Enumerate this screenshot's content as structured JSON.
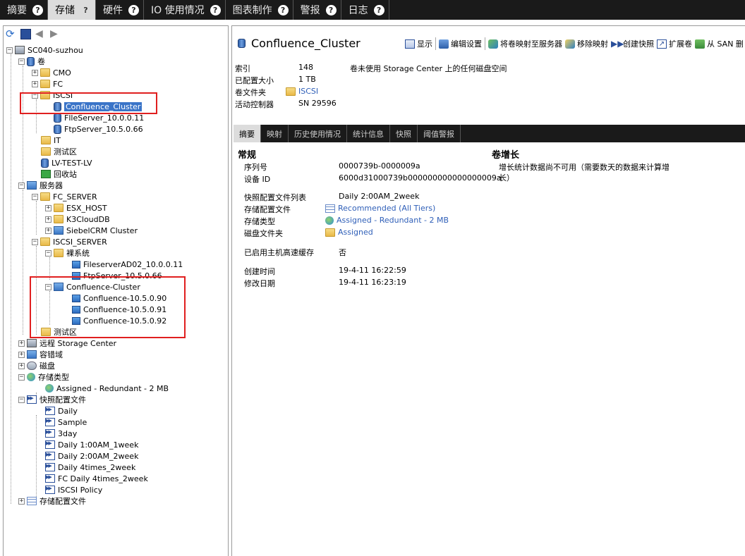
{
  "top_tabs": [
    {
      "label": "摘要"
    },
    {
      "label": "存储"
    },
    {
      "label": "硬件"
    },
    {
      "label": "IO 使用情况"
    },
    {
      "label": "图表制作"
    },
    {
      "label": "警报"
    },
    {
      "label": "日志"
    }
  ],
  "top_tab_help": "?",
  "tree": {
    "root": "SC040-suzhou",
    "volumes": "卷",
    "cmo": "CMO",
    "fc": "FC",
    "iscsi": "ISCSI",
    "confluence_cluster": "Confluence_Cluster",
    "fileserver": "FlleServer_10.0.0.11",
    "ftpserver": "FtpServer_10.5.0.66",
    "it": "IT",
    "test_area": "测试区",
    "lv_test": "LV-TEST-LV",
    "recycle": "回收站",
    "servers": "服务器",
    "fc_server": "FC_SERVER",
    "esx_host": "ESX_HOST",
    "k3clouddb": "K3CloudDB",
    "siebelcrm": "SiebelCRM Cluster",
    "iscsi_server": "ISCSI_SERVER",
    "bare_system": "裸系统",
    "fileserver_ad02": "FileserverAD02_10.0.0.11",
    "ftpserver_srv": "FtpServer_10.5.0.66",
    "confluence_cluster_srv": "Confluence-Cluster",
    "conf90": "Confluence-10.5.0.90",
    "conf91": "Confluence-10.5.0.91",
    "conf92": "Confluence-10.5.0.92",
    "test_area2": "测试区",
    "remote_sc": "远程 Storage Center",
    "fault_domain": "容错域",
    "disks": "磁盘",
    "storage_type": "存储类型",
    "assigned_redundant": "Assigned - Redundant - 2 MB",
    "snapshot_profiles": "快照配置文件",
    "snap_daily": "Daily",
    "snap_sample": "Sample",
    "snap_3day": "3day",
    "snap_d1": "Daily 1:00AM_1week",
    "snap_d2": "Daily 2:00AM_2week",
    "snap_d4": "Daily 4times_2week",
    "snap_fc": "FC Daily 4times_2week",
    "snap_iscsi": "ISCSI Policy",
    "storage_profiles": "存储配置文件"
  },
  "volume": {
    "title": "Confluence_Cluster",
    "actions": {
      "show": "显示",
      "edit": "编辑设置",
      "map": "将卷映射至服务器",
      "unmap": "移除映射",
      "snapshot": "创建快照",
      "expand": "扩展卷",
      "from_san": "从 SAN 删"
    },
    "index_label": "索引",
    "index_value": "148",
    "index_note": "卷未使用 Storage Center 上的任何磁盘空间",
    "size_label": "已配置大小",
    "size_value": "1 TB",
    "folder_label": "卷文件夹",
    "folder_value": "ISCSI",
    "controller_label": "活动控制器",
    "controller_value": "SN 29596"
  },
  "sub_tabs": [
    "摘要",
    "映射",
    "历史使用情况",
    "统计信息",
    "快照",
    "阈值警报"
  ],
  "summary": {
    "general_title": "常规",
    "growth_title": "卷增长",
    "growth_text_1": "增长统计数据尚不可用（需要数天的数据来计算增",
    "growth_text_2": "长）",
    "serial_label": "序列号",
    "serial_value": "0000739b-0000009a",
    "device_label": "设备 ID",
    "device_value": "6000d31000739b000000000000000009a",
    "snap_profiles_label": "快照配置文件列表",
    "snap_profiles_value": "Daily 2:00AM_2week",
    "storage_profile_label": "存储配置文件",
    "storage_profile_value": "Recommended (All Tiers)",
    "storage_type_label": "存储类型",
    "storage_type_value": "Assigned - Redundant - 2 MB",
    "disk_folder_label": "磁盘文件夹",
    "disk_folder_value": "Assigned",
    "cache_label": "已启用主机高速缓存",
    "cache_value": "否",
    "created_label": "创建时间",
    "created_value": "19-4-11 16:22:59",
    "modified_label": "修改日期",
    "modified_value": "19-4-11 16:23:19"
  },
  "colors": {
    "highlight_box": "#e01f1f",
    "selection": "#3a74c8",
    "link": "#2f5fb8"
  }
}
